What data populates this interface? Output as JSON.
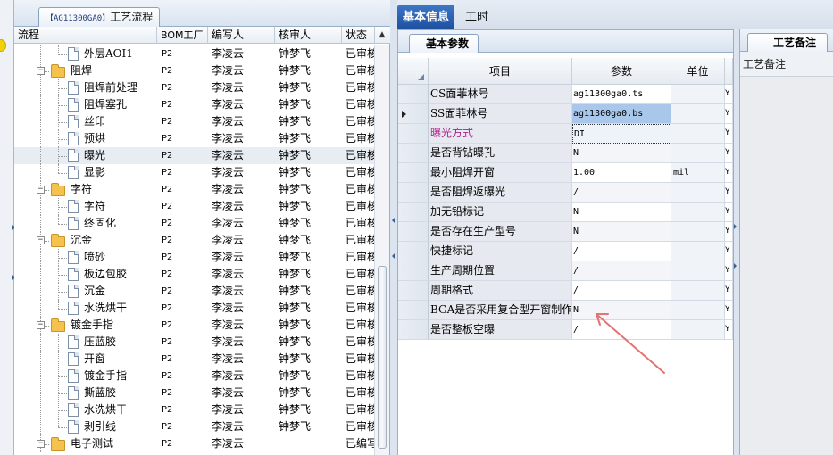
{
  "tree": {
    "tab_label_code": "【AG11300GA0】",
    "tab_label_text": "工艺流程",
    "columns": [
      "流程",
      "BOM工厂",
      "编写人",
      "核审人",
      "状态"
    ],
    "rows": [
      {
        "level": 2,
        "type": "doc",
        "label": "外层AOI1",
        "bom": "P2",
        "writer": "李凌云",
        "reviewer": "钟梦飞",
        "status": "已审核",
        "last": true
      },
      {
        "level": 1,
        "type": "folder",
        "label": "阻焊",
        "bom": "P2",
        "writer": "李凌云",
        "reviewer": "钟梦飞",
        "status": "已审核"
      },
      {
        "level": 2,
        "type": "doc",
        "label": "阻焊前处理",
        "bom": "P2",
        "writer": "李凌云",
        "reviewer": "钟梦飞",
        "status": "已审核"
      },
      {
        "level": 2,
        "type": "doc",
        "label": "阻焊塞孔",
        "bom": "P2",
        "writer": "李凌云",
        "reviewer": "钟梦飞",
        "status": "已审核"
      },
      {
        "level": 2,
        "type": "doc",
        "label": "丝印",
        "bom": "P2",
        "writer": "李凌云",
        "reviewer": "钟梦飞",
        "status": "已审核"
      },
      {
        "level": 2,
        "type": "doc",
        "label": "预烘",
        "bom": "P2",
        "writer": "李凌云",
        "reviewer": "钟梦飞",
        "status": "已审核"
      },
      {
        "level": 2,
        "type": "doc",
        "label": "曝光",
        "bom": "P2",
        "writer": "李凌云",
        "reviewer": "钟梦飞",
        "status": "已审核",
        "selected": true
      },
      {
        "level": 2,
        "type": "doc",
        "label": "显影",
        "bom": "P2",
        "writer": "李凌云",
        "reviewer": "钟梦飞",
        "status": "已审核",
        "last": true
      },
      {
        "level": 1,
        "type": "folder",
        "label": "字符",
        "bom": "P2",
        "writer": "李凌云",
        "reviewer": "钟梦飞",
        "status": "已审核"
      },
      {
        "level": 2,
        "type": "doc",
        "label": "字符",
        "bom": "P2",
        "writer": "李凌云",
        "reviewer": "钟梦飞",
        "status": "已审核"
      },
      {
        "level": 2,
        "type": "doc",
        "label": "终固化",
        "bom": "P2",
        "writer": "李凌云",
        "reviewer": "钟梦飞",
        "status": "已审核",
        "last": true
      },
      {
        "level": 1,
        "type": "folder",
        "label": "沉金",
        "bom": "P2",
        "writer": "李凌云",
        "reviewer": "钟梦飞",
        "status": "已审核"
      },
      {
        "level": 2,
        "type": "doc",
        "label": "喷砂",
        "bom": "P2",
        "writer": "李凌云",
        "reviewer": "钟梦飞",
        "status": "已审核"
      },
      {
        "level": 2,
        "type": "doc",
        "label": "板边包胶",
        "bom": "P2",
        "writer": "李凌云",
        "reviewer": "钟梦飞",
        "status": "已审核"
      },
      {
        "level": 2,
        "type": "doc",
        "label": "沉金",
        "bom": "P2",
        "writer": "李凌云",
        "reviewer": "钟梦飞",
        "status": "已审核"
      },
      {
        "level": 2,
        "type": "doc",
        "label": "水洗烘干",
        "bom": "P2",
        "writer": "李凌云",
        "reviewer": "钟梦飞",
        "status": "已审核",
        "last": true
      },
      {
        "level": 1,
        "type": "folder",
        "label": "镀金手指",
        "bom": "P2",
        "writer": "李凌云",
        "reviewer": "钟梦飞",
        "status": "已审核"
      },
      {
        "level": 2,
        "type": "doc",
        "label": "压蓝胶",
        "bom": "P2",
        "writer": "李凌云",
        "reviewer": "钟梦飞",
        "status": "已审核"
      },
      {
        "level": 2,
        "type": "doc",
        "label": "开窗",
        "bom": "P2",
        "writer": "李凌云",
        "reviewer": "钟梦飞",
        "status": "已审核"
      },
      {
        "level": 2,
        "type": "doc",
        "label": "镀金手指",
        "bom": "P2",
        "writer": "李凌云",
        "reviewer": "钟梦飞",
        "status": "已审核"
      },
      {
        "level": 2,
        "type": "doc",
        "label": "撕蓝胶",
        "bom": "P2",
        "writer": "李凌云",
        "reviewer": "钟梦飞",
        "status": "已审核"
      },
      {
        "level": 2,
        "type": "doc",
        "label": "水洗烘干",
        "bom": "P2",
        "writer": "李凌云",
        "reviewer": "钟梦飞",
        "status": "已审核"
      },
      {
        "level": 2,
        "type": "doc",
        "label": "剥引线",
        "bom": "P2",
        "writer": "李凌云",
        "reviewer": "钟梦飞",
        "status": "已审核",
        "last": true
      },
      {
        "level": 1,
        "type": "folder",
        "label": "电子测试",
        "bom": "P2",
        "writer": "李凌云",
        "reviewer": "",
        "status": "已编写"
      }
    ]
  },
  "main_tabs": {
    "basic_info": "基本信息",
    "work_hours": "工时"
  },
  "params": {
    "tab_label": "基本参数",
    "columns": {
      "item": "项目",
      "value": "参数",
      "unit": "单位"
    },
    "rows": [
      {
        "item": "CS面菲林号",
        "value": "ag11300ga0.ts",
        "unit": "",
        "extra": "Y"
      },
      {
        "item": "SS面菲林号",
        "value": "ag11300ga0.bs",
        "unit": "",
        "extra": "Y",
        "selected": true,
        "pointer": true
      },
      {
        "item": "曝光方式",
        "value": "DI",
        "unit": "",
        "extra": "Y",
        "focused": true,
        "magenta": true
      },
      {
        "item": "是否背钻曝孔",
        "value": "N",
        "unit": "",
        "extra": "Y"
      },
      {
        "item": "最小阻焊开窗",
        "value": "1.00",
        "unit": "mil",
        "extra": "Y"
      },
      {
        "item": "是否阻焊返曝光",
        "value": "/",
        "unit": "",
        "extra": "Y"
      },
      {
        "item": "加无铅标记",
        "value": "N",
        "unit": "",
        "extra": "Y"
      },
      {
        "item": "是否存在生产型号",
        "value": "N",
        "unit": "",
        "extra": "Y"
      },
      {
        "item": "快捷标记",
        "value": "/",
        "unit": "",
        "extra": "Y"
      },
      {
        "item": "生产周期位置",
        "value": "/",
        "unit": "",
        "extra": "Y"
      },
      {
        "item": "周期格式",
        "value": "/",
        "unit": "",
        "extra": "Y"
      },
      {
        "item": "BGA是否采用复合型开窗制作",
        "value": "N",
        "unit": "",
        "extra": "Y"
      },
      {
        "item": "是否整板空曝",
        "value": "/",
        "unit": "",
        "extra": "Y"
      }
    ]
  },
  "notes": {
    "tab_label": "工艺备注",
    "column_label": "工艺备注"
  },
  "icons": {
    "folder": "folder-icon",
    "doc": "document-icon",
    "expander": "collapse-minus-icon",
    "pointer": "row-pointer-icon",
    "annotation": "annotation-arrow-icon"
  },
  "colors": {
    "active_tab": "#1d4f9f",
    "highlight_item": "#b0208a",
    "selected_value": "#a8c7ea",
    "annotation_arrow": "#e57373"
  }
}
